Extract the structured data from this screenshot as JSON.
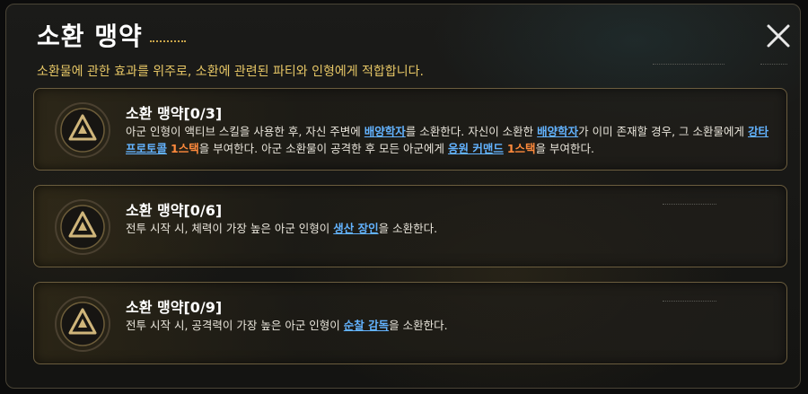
{
  "header": {
    "title": "소환 맹약",
    "subtitle": "소환물에 관한 효과를 위주로, 소환에 관련된 파티와 인형에게 적합합니다."
  },
  "cards": [
    {
      "title": "소환 맹약[0/3]",
      "desc": [
        {
          "t": "text",
          "v": "아군 인형이 액티브 스킬을 사용한 후, 자신 주변에 "
        },
        {
          "t": "link",
          "v": "배양학자"
        },
        {
          "t": "text",
          "v": "를 소환한다. 자신이 소환한 "
        },
        {
          "t": "link",
          "v": "배양학자"
        },
        {
          "t": "text",
          "v": "가 이미 존재할 경우, 그 소환물에게 "
        },
        {
          "t": "link",
          "v": "강타 프로토콜"
        },
        {
          "t": "text",
          "v": " "
        },
        {
          "t": "hl",
          "v": "1스택"
        },
        {
          "t": "text",
          "v": "을 부여한다. 아군 소환물이 공격한 후 모든 아군에게 "
        },
        {
          "t": "link",
          "v": "응원 커맨드"
        },
        {
          "t": "text",
          "v": " "
        },
        {
          "t": "hl",
          "v": "1스택"
        },
        {
          "t": "text",
          "v": "을 부여한다."
        }
      ]
    },
    {
      "title": "소환 맹약[0/6]",
      "desc": [
        {
          "t": "text",
          "v": "전투 시작 시, 체력이 가장 높은 아군 인형이 "
        },
        {
          "t": "link",
          "v": "생산 장인"
        },
        {
          "t": "text",
          "v": "을 소환한다."
        }
      ]
    },
    {
      "title": "소환 맹약[0/9]",
      "desc": [
        {
          "t": "text",
          "v": "전투 시작 시, 공격력이 가장 높은 아군 인형이 "
        },
        {
          "t": "link",
          "v": "순찰 감독"
        },
        {
          "t": "text",
          "v": "을 소환한다."
        }
      ]
    }
  ],
  "colors": {
    "accent": "#e7c766",
    "link": "#63b3ff",
    "highlight": "#ff8a3c"
  },
  "icons": {
    "close": "close-icon",
    "card": "summon-pact-emblem-icon"
  }
}
